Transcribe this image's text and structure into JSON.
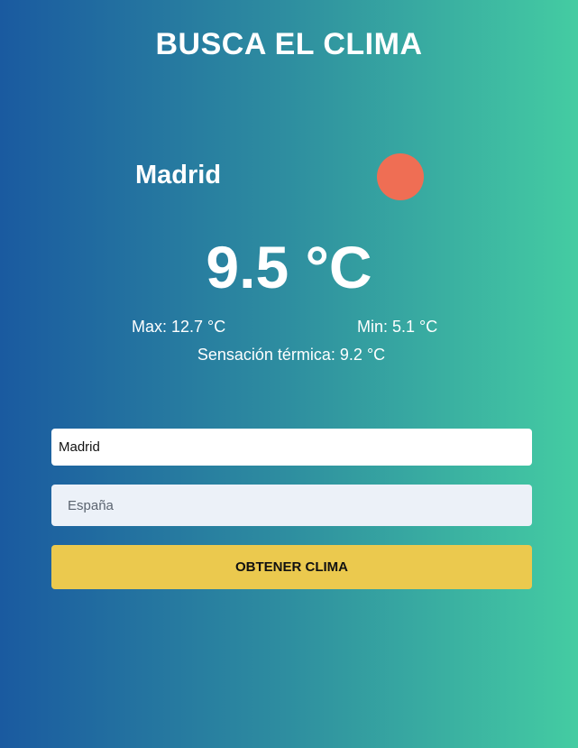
{
  "header": {
    "title": "BUSCA EL CLIMA"
  },
  "weather": {
    "city": "Madrid",
    "icon": "sun-icon",
    "icon_color": "#ef6e54",
    "temperature": "9.5 °C",
    "max": "Max: 12.7 °C",
    "min": "Min: 5.1 °C",
    "feels_like": "Sensación térmica: 9.2 °C"
  },
  "form": {
    "city_value": "Madrid",
    "country_placeholder": "España",
    "submit_label": "OBTENER CLIMA"
  },
  "colors": {
    "gradient_start": "#1a5aa0",
    "gradient_end": "#44cca2",
    "button": "#ebc94e"
  }
}
